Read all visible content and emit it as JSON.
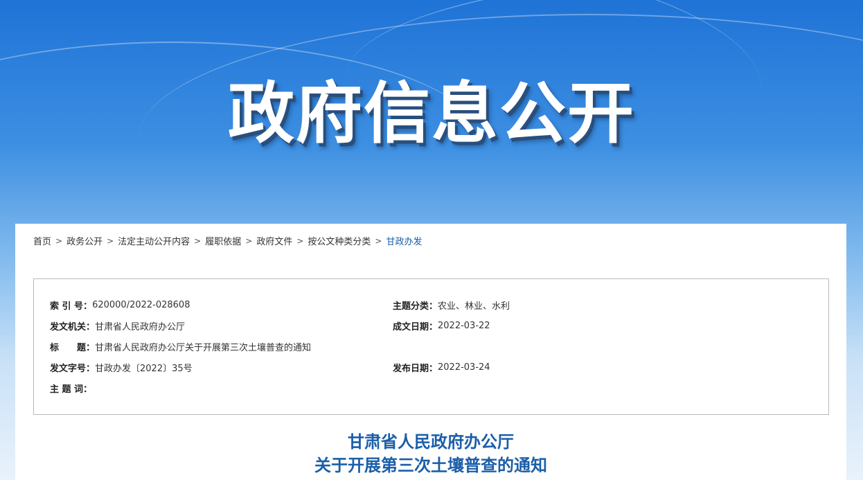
{
  "banner": {
    "title": "政府信息公开"
  },
  "breadcrumb": [
    {
      "label": "首页"
    },
    {
      "label": "政务公开"
    },
    {
      "label": "法定主动公开内容"
    },
    {
      "label": "履职依据"
    },
    {
      "label": "政府文件"
    },
    {
      "label": "按公文种类分类"
    },
    {
      "label": "甘政办发"
    }
  ],
  "breadcrumb_separator": ">",
  "info": {
    "index_no": {
      "label": "索 引 号：",
      "value": "620000/2022-028608"
    },
    "category": {
      "label": "主题分类：",
      "value": "农业、林业、水利"
    },
    "issuer": {
      "label": "发文机关：",
      "value": "甘肃省人民政府办公厅"
    },
    "written_date": {
      "label": "成文日期：",
      "value": "2022-03-22"
    },
    "title": {
      "label": "标　　题：",
      "value": "甘肃省人民政府办公厅关于开展第三次土壤普查的通知"
    },
    "doc_number": {
      "label": "发文字号：",
      "value": "甘政办发〔2022〕35号"
    },
    "publish_date": {
      "label": "发布日期：",
      "value": "2022-03-24"
    },
    "keywords": {
      "label": "主 题 词：",
      "value": ""
    }
  },
  "document": {
    "title_line1": "甘肃省人民政府办公厅",
    "title_line2": "关于开展第三次土壤普查的通知"
  },
  "colors": {
    "accent": "#1a5ea9",
    "banner_top": "#1f73d6",
    "border": "#b9b9b9"
  }
}
